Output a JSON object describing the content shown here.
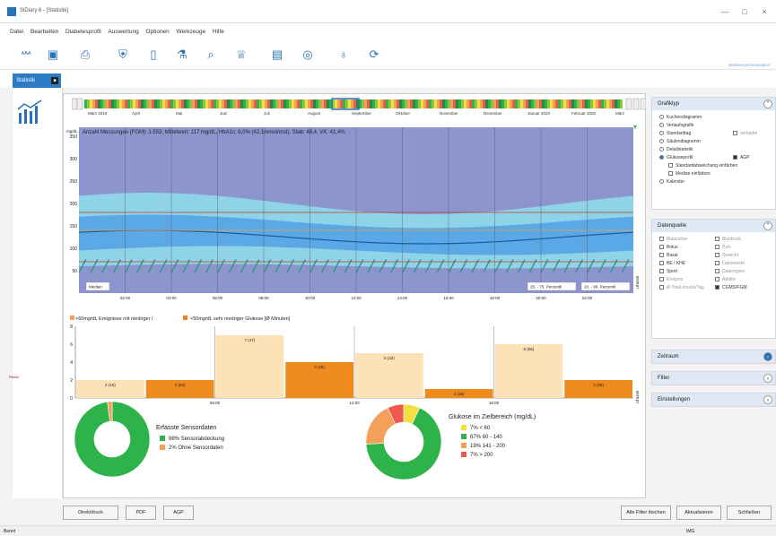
{
  "window": {
    "title": "SiDiary 6 - [Statistik]",
    "ctl_min": "—",
    "ctl_max": "□",
    "ctl_close": "×"
  },
  "menu": [
    "Datei",
    "Bearbeiten",
    "Diabetesprofil",
    "Auswertung",
    "Optionen",
    "Werkzeuge",
    "Hilfe"
  ],
  "toolbar": {
    "link_label": "Webtexsynchronisation"
  },
  "tab": {
    "label": "Statistik",
    "close": "■"
  },
  "timeline": {
    "months": [
      "März 2019",
      "April",
      "Mai",
      "Juni",
      "Juli",
      "August",
      "September",
      "Oktober",
      "November",
      "Dezember",
      "Januar 2020",
      "Februar 2020",
      "März"
    ]
  },
  "agp": {
    "header": "Anzahl Messungen (FGM): 1.553, Mittelwert: 117 mg/dL, HbA1c: 6,0% (42,1mmol/mol), Stab: 48,4, VK: 41,4%",
    "unit": "mg/dL",
    "y_ticks": [
      "350",
      "300",
      "250",
      "200",
      "150",
      "100",
      "50"
    ],
    "x_ticks": [
      "02:00",
      "04:00",
      "06:00",
      "08:00",
      "10:00",
      "12:00",
      "14:00",
      "16:00",
      "18:00",
      "20:00",
      "22:00"
    ],
    "median_label": "Median",
    "p25_label": "25. - 75. Perzentil",
    "p10_label": "10. - 90. Perzentil",
    "side_label": "Uhrzeit",
    "colors": {
      "outer": "#8fd3e8",
      "inner": "#5aa9e6",
      "median": "#1c5a9e",
      "target_band": "#3d8fd0",
      "hatch": "#2e9a7a",
      "bg": "#8d95cf"
    },
    "target_low": 70,
    "target_high": 180
  },
  "events": {
    "legend1": "<60mg/dL Ereignisse mit niedriger /",
    "legend2": "<50mg/dL sehr niedriger Glukose [Ø Minuten]",
    "y_ticks": [
      "8",
      "6",
      "4",
      "2",
      "0"
    ],
    "x_ticks": [
      "06:00",
      "12:00",
      "18:00"
    ],
    "side_label": "Uhrzeit",
    "bar_labels": [
      "2 (15)",
      "2 (64)",
      "7 (47)",
      "4 (28)",
      "5 (32)",
      "1 (15)",
      "6 (66)",
      "2 (28)"
    ],
    "bar_values": [
      2,
      2,
      7,
      4,
      5,
      1,
      6,
      2
    ]
  },
  "donut1": {
    "title": "Erfasste Sensordaten",
    "rows": [
      {
        "pct": "98%",
        "label": "Sensorabdeckung",
        "color": "#2db34a"
      },
      {
        "pct": "2%",
        "label": "Ohne Sensordaten",
        "color": "#f4a05a"
      }
    ],
    "values": [
      98,
      2
    ]
  },
  "donut2": {
    "title": "Glukose im Zielbereich (mg/dL)",
    "rows": [
      {
        "pct": "7%",
        "label": "< 60",
        "color": "#f5e042"
      },
      {
        "pct": "67%",
        "label": "60 - 140",
        "color": "#2db34a"
      },
      {
        "pct": "19%",
        "label": "141 - 200",
        "color": "#f4a05a"
      },
      {
        "pct": "7%",
        "label": "> 200",
        "color": "#ee5a4f"
      }
    ],
    "values": [
      7,
      67,
      19,
      7
    ]
  },
  "sidebar": {
    "grafiktyp": {
      "title": "Grafiktyp",
      "options": [
        "Kuchendiagramm",
        "Verlaufsgrafik",
        "Standardtag",
        "Säulendiagramm",
        "Detailstatistik",
        "Glukoseprofil",
        "Kalender"
      ],
      "selected": "Glukoseprofil",
      "verbatim_label": "verbatim",
      "agp_label": "AGP",
      "std_label": "Standardabweichung einfärben",
      "median_label": "Median einfärben"
    },
    "datenquelle": {
      "title": "Datenquelle",
      "left": [
        "Blutzucker",
        "Bolus",
        "Basal",
        "BE / KHE",
        "Sport",
        "Ereignis",
        "Ø-Total-Insulin/Tag"
      ],
      "right": [
        "Blutdruck",
        "Puls",
        "Gewicht",
        "Laborwerte",
        "Datentypen",
        "Additiv",
        "CGMS/FGM"
      ],
      "checked_left": [
        "Bolus",
        "Basal",
        "BE / KHE",
        "Sport"
      ],
      "checked_right": [
        "CGMS/FGM"
      ]
    },
    "zeitraum": "Zeitraum",
    "filter": "Filter",
    "einstellungen": "Einstellungen"
  },
  "buttons": {
    "druck": "Direktdruck",
    "pdf": "PDF",
    "agp": "AGP",
    "filter_loeschen": "Alle Filter löschen",
    "aktualisieren": "Aktualisieren",
    "schliessen": "Schließen"
  },
  "status": {
    "left": "Bereit",
    "right": "IMG"
  },
  "left_label": "Rbeal"
}
